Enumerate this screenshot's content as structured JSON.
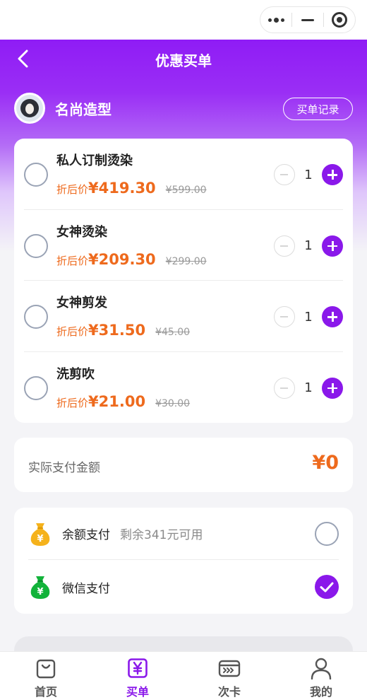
{
  "nav": {
    "title": "优惠买单"
  },
  "store": {
    "name": "名尚造型",
    "records_label": "买单记录"
  },
  "services": [
    {
      "name": "私人订制烫染",
      "price_label": "折后价",
      "price": "¥419.30",
      "original": "¥599.00",
      "qty": "1"
    },
    {
      "name": "女神烫染",
      "price_label": "折后价",
      "price": "¥209.30",
      "original": "¥299.00",
      "qty": "1"
    },
    {
      "name": "女神剪发",
      "price_label": "折后价",
      "price": "¥31.50",
      "original": "¥45.00",
      "qty": "1"
    },
    {
      "name": "洗剪吹",
      "price_label": "折后价",
      "price": "¥21.00",
      "original": "¥30.00",
      "qty": "1"
    }
  ],
  "amount": {
    "label": "实际支付金额",
    "value": "¥0"
  },
  "payment": [
    {
      "name": "余额支付",
      "note": "剩余341元可用",
      "icon": "money-bag-yellow-icon",
      "selected": false
    },
    {
      "name": "微信支付",
      "icon": "money-bag-green-icon",
      "selected": true
    }
  ],
  "tabs": [
    {
      "label": "首页",
      "icon": "shopping-bag-icon",
      "active": false
    },
    {
      "label": "买单",
      "icon": "yen-icon",
      "active": true
    },
    {
      "label": "次卡",
      "icon": "card-icon",
      "active": false
    },
    {
      "label": "我的",
      "icon": "user-icon",
      "active": false
    }
  ],
  "colors": {
    "accent": "#8a18ea",
    "price": "#ee6a1d",
    "header_top": "#8f1cf5"
  }
}
